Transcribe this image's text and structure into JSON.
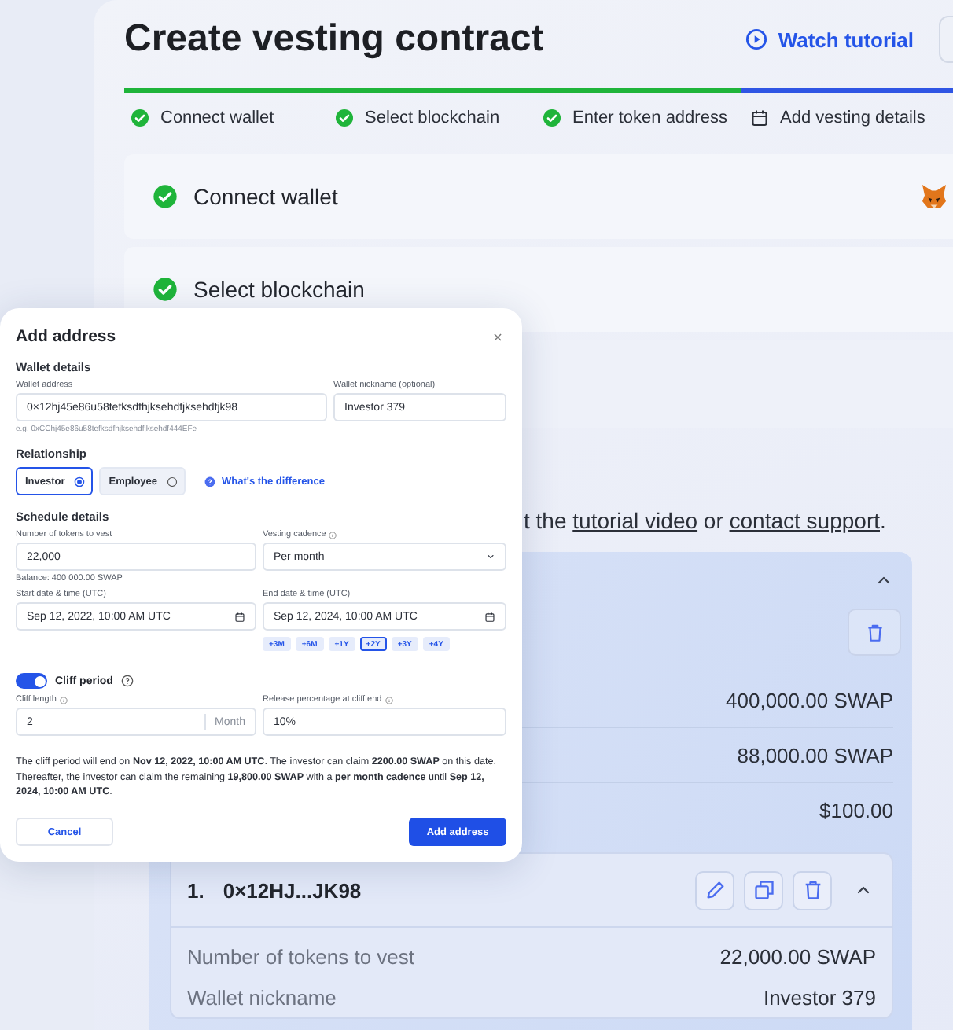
{
  "page": {
    "title": "Create vesting contract",
    "tutorial_button": "Watch tutorial"
  },
  "progress": {
    "level": 0.71
  },
  "steps": [
    {
      "label": "Connect wallet",
      "done": true
    },
    {
      "label": "Select blockchain",
      "done": true
    },
    {
      "label": "Enter token address",
      "done": true
    },
    {
      "label": "Add vesting details",
      "done": false
    }
  ],
  "sections": [
    {
      "kind": "wallet",
      "title": "Connect wallet",
      "done": true
    },
    {
      "kind": "plain",
      "title": "Select blockchain",
      "done": true
    },
    {
      "kind": "blank"
    }
  ],
  "help_text": [
    {
      "kind": "text",
      "text": "t the "
    },
    {
      "kind": "link",
      "text": "tutorial video"
    },
    {
      "kind": "text",
      "text": " or "
    },
    {
      "kind": "link",
      "text": "contact support"
    },
    {
      "kind": "text",
      "text": "."
    }
  ],
  "summary": {
    "expanded": true,
    "rows": [
      {
        "value": "400,000.00 SWAP"
      },
      {
        "value": "88,000.00 SWAP"
      },
      {
        "value": "$100.00"
      }
    ]
  },
  "recipients": [
    {
      "index": "1.",
      "address": "0×12HJ...JK98",
      "expanded": true,
      "rows": [
        {
          "label": "Number of tokens to vest",
          "value": "22,000.00 SWAP"
        },
        {
          "label": "Wallet nickname",
          "value": "Investor 379"
        }
      ]
    }
  ],
  "modal": {
    "title": "Add address",
    "wallet": {
      "heading": "Wallet details",
      "address": {
        "label": "Wallet address",
        "value": "0×12hj45e86u58tefksdfhjksehdfjksehdfjk98",
        "hint": "e.g. 0xCChj45e86u58tefksdfhjksehdfjksehdf444EFe"
      },
      "nickname": {
        "label": "Wallet nickname (optional)",
        "value": "Investor 379"
      }
    },
    "relationship": {
      "heading": "Relationship",
      "options": [
        {
          "label": "Investor",
          "selected": true
        },
        {
          "label": "Employee",
          "selected": false
        }
      ],
      "help_link": "What's the difference"
    },
    "schedule": {
      "heading": "Schedule details",
      "tokens": {
        "label": "Number of tokens to vest",
        "value": "22,000",
        "hint": "Balance: 400 000.00 SWAP"
      },
      "cadence": {
        "label": "Vesting cadence",
        "value": "Per month"
      },
      "start": {
        "label": "Start date & time (UTC)",
        "value": "Sep 12, 2022, 10:00 AM UTC"
      },
      "end": {
        "label": "End date & time (UTC)",
        "value": "Sep 12, 2024, 10:00 AM UTC"
      },
      "presets": [
        {
          "label": "+3M",
          "selected": false
        },
        {
          "label": "+6M",
          "selected": false
        },
        {
          "label": "+1Y",
          "selected": false
        },
        {
          "label": "+2Y",
          "selected": true
        },
        {
          "label": "+3Y",
          "selected": false
        },
        {
          "label": "+4Y",
          "selected": false
        }
      ]
    },
    "cliff": {
      "label": "Cliff period",
      "on": true,
      "length": {
        "label": "Cliff length",
        "value": "2",
        "unit": "Month"
      },
      "release": {
        "label": "Release percentage at cliff end",
        "value": "10%"
      }
    },
    "note": "The cliff period will end on **Nov 12, 2022, 10:00 AM UTC**. The investor can claim **2200.00 SWAP** on this date. Thereafter, the investor can claim the remaining **19,800.00 SWAP** with a **per month cadence** until **Sep 12, 2024, 10:00 AM UTC**.",
    "buttons": [
      {
        "kind": "secondary",
        "label": "Cancel"
      },
      {
        "kind": "primary",
        "label": "Add address"
      }
    ]
  }
}
